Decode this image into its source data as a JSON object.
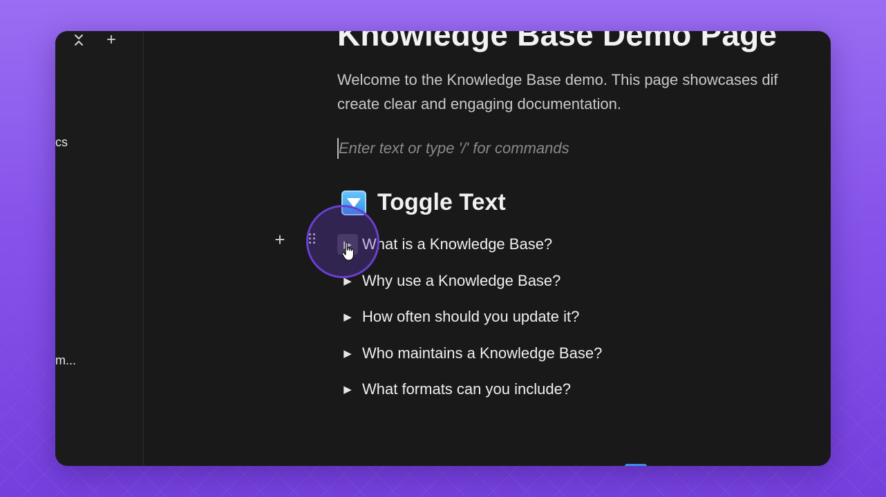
{
  "sidebar": {
    "collapse_icon": "chevrons-collapse-icon",
    "add_icon": "plus-icon",
    "items": [
      {
        "label": "cs"
      },
      {
        "label": "m..."
      }
    ]
  },
  "page": {
    "title": "Knowledge Base Demo Page",
    "intro_line1": "Welcome to the Knowledge Base demo. This page showcases dif",
    "intro_line2": "create clear and engaging documentation.",
    "placeholder": "Enter text or type '/' for commands",
    "section_heading": "Toggle Text",
    "section_emoji": "toggle-emoji-icon",
    "toggles": [
      {
        "label": "What is a Knowledge Base?"
      },
      {
        "label": "Why use a Knowledge Base?"
      },
      {
        "label": "How often should you update it?"
      },
      {
        "label": "Who maintains a Knowledge Base?"
      },
      {
        "label": "What formats can you include?"
      }
    ]
  },
  "block_controls": {
    "add_icon": "plus-icon",
    "drag_icon": "drag-handle-icon"
  },
  "colors": {
    "background": "#8653ea",
    "window": "#191919",
    "click_highlight": "#6a3fd0",
    "emoji_blue": "#2f8fe6"
  }
}
